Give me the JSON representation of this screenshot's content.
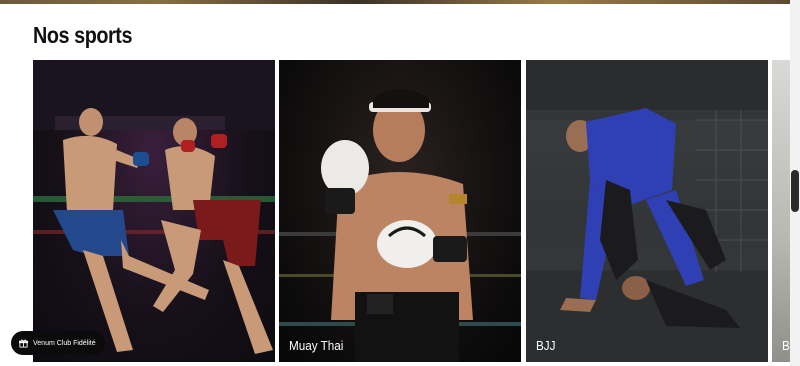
{
  "section": {
    "title": "Nos sports"
  },
  "cards": [
    {
      "label": "",
      "image": "mma-fighters-kick"
    },
    {
      "label": "Muay Thai",
      "image": "muay-thai-fighter"
    },
    {
      "label": "BJJ",
      "image": "bjj-grappling"
    },
    {
      "label": "Bo",
      "image": "partial-card"
    }
  ],
  "loyalty": {
    "label": "Venum Club Fidélité",
    "icon": "gift-icon"
  },
  "colors": {
    "title": "#111111",
    "button_bg": "#0b0b0b",
    "scroll_thumb": "#2b2b2b"
  }
}
